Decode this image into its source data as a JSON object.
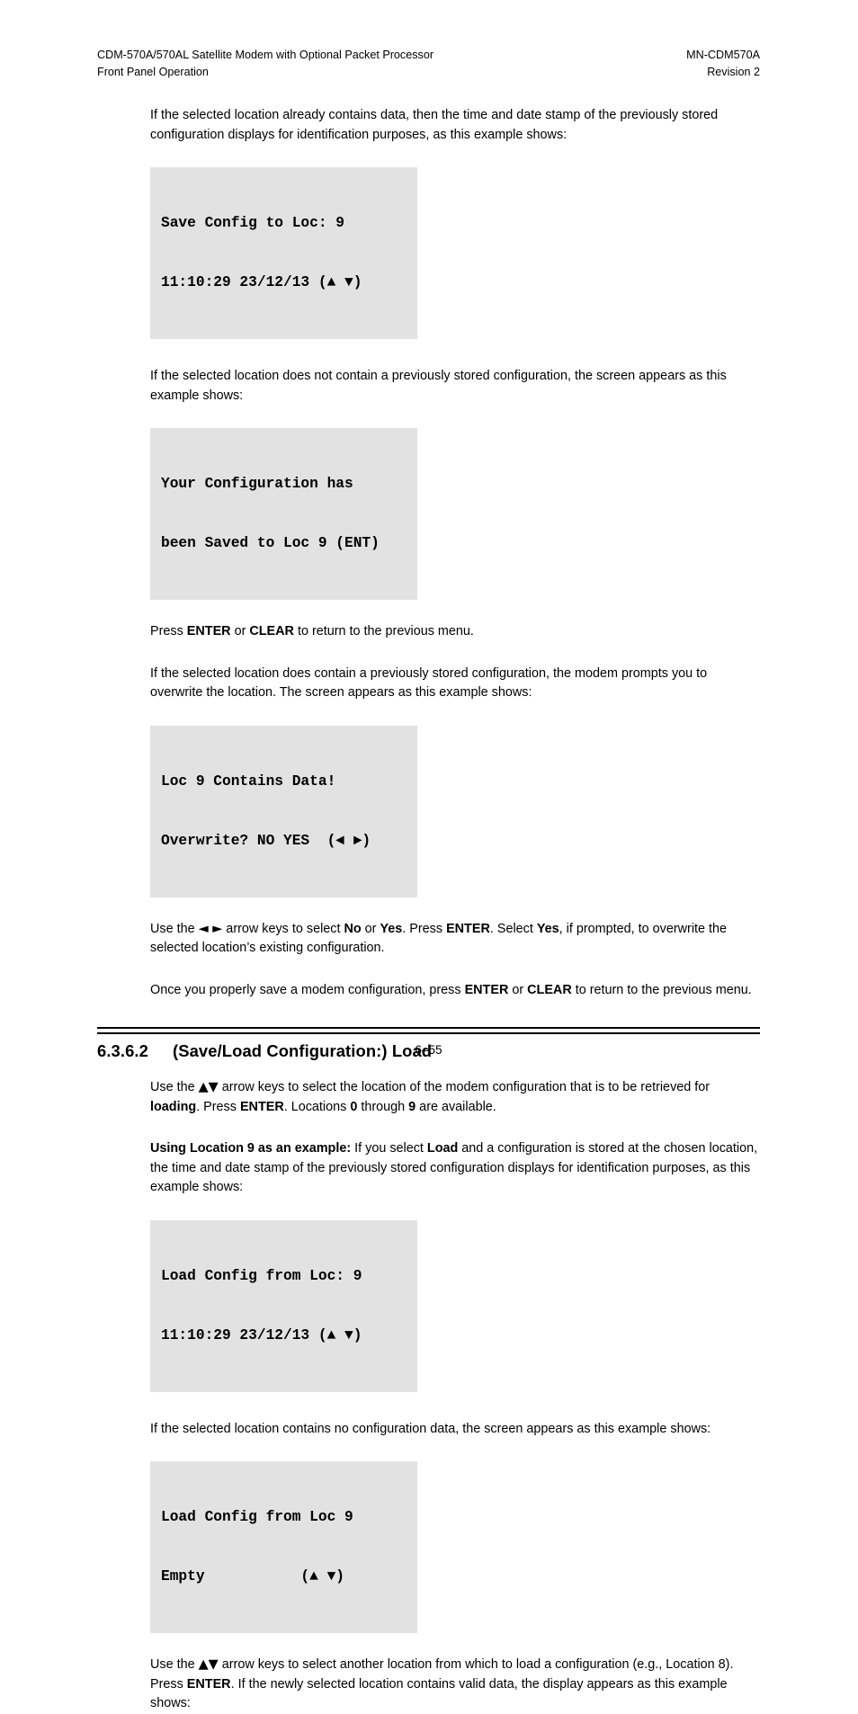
{
  "header": {
    "left_line1": "CDM-570A/570AL Satellite Modem with Optional Packet Processor",
    "left_line2": "Front Panel Operation",
    "right_line1": "MN-CDM570A",
    "right_line2": "Revision 2"
  },
  "paragraphs": {
    "p1": "If the selected location already contains data, then the time and date stamp of the previously stored configuration displays for identification purposes, as this example shows:",
    "p2": "If the selected location does not contain a previously stored configuration, the screen appears as this example shows:",
    "p3_pre": "Press ",
    "p3_b1": "ENTER",
    "p3_mid": " or ",
    "p3_b2": "CLEAR",
    "p3_post": " to return to the previous menu.",
    "p4": "If the selected location does contain a previously stored configuration, the modem prompts you to overwrite the location. The screen appears as this example shows:",
    "p5_pre": "Use the ",
    "p5_arrows": "◄ ►",
    "p5_a": " arrow keys to select ",
    "p5_b1": "No",
    "p5_b": " or ",
    "p5_b2": "Yes",
    "p5_c": ". Press ",
    "p5_b3": "ENTER",
    "p5_d": ". Select ",
    "p5_b4": "Yes",
    "p5_e": ", if prompted, to overwrite the selected location’s existing configuration.",
    "p6_pre": "Once you properly save a modem configuration, press ",
    "p6_b1": "ENTER",
    "p6_mid": " or ",
    "p6_b2": "CLEAR",
    "p6_post": " to return to the previous menu.",
    "p7_pre": "Use the ",
    "p7_arrows": "▲▼",
    "p7_a": " arrow keys to select the location of the modem configuration that is to be retrieved for ",
    "p7_b1": "loading",
    "p7_b": ". Press ",
    "p7_b2": "ENTER",
    "p7_c": ". Locations ",
    "p7_b3": "0",
    "p7_d": " through ",
    "p7_b4": "9",
    "p7_e": " are available.",
    "p8_b1": "Using Location 9 as an example:",
    "p8_a": " If you select ",
    "p8_b2": "Load",
    "p8_b": " and a configuration is stored at the chosen location, the time and date stamp of the previously stored configuration displays for identification purposes, as this example shows:",
    "p9": "If the selected location contains no configuration data, the screen appears as this example shows:",
    "p10_pre": "Use the ",
    "p10_arrows": "▲▼",
    "p10_a": " arrow keys to select another location from which to load a configuration (e.g., Location 8). Press ",
    "p10_b1": "ENTER",
    "p10_b": ". If the newly selected location contains valid data, the display appears as this example shows:"
  },
  "lcd_screens": {
    "save_config": {
      "line1": "Save Config to Loc: 9",
      "line2": "11:10:29 23/12/13 (▲ ▼)"
    },
    "saved_confirm": {
      "line1": "Your Configuration has",
      "line2": "been Saved to Loc 9 (ENT)"
    },
    "overwrite_prompt": {
      "line1": "Loc 9 Contains Data!",
      "line2": "Overwrite? NO YES  (◄ ►)"
    },
    "load_config": {
      "line1": "Load Config from Loc: 9",
      "line2": "11:10:29 23/12/13 (▲ ▼)"
    },
    "load_empty": {
      "line1": "Load Config from Loc 9",
      "line2": "Empty           (▲ ▼)"
    }
  },
  "section": {
    "number": "6.3.6.2",
    "title": "(Save/Load Configuration:) Load"
  },
  "footer": {
    "page_number": "6–55"
  },
  "colors": {
    "lcd_background": "#e2e2e2",
    "text": "#000000",
    "page_background": "#ffffff"
  }
}
